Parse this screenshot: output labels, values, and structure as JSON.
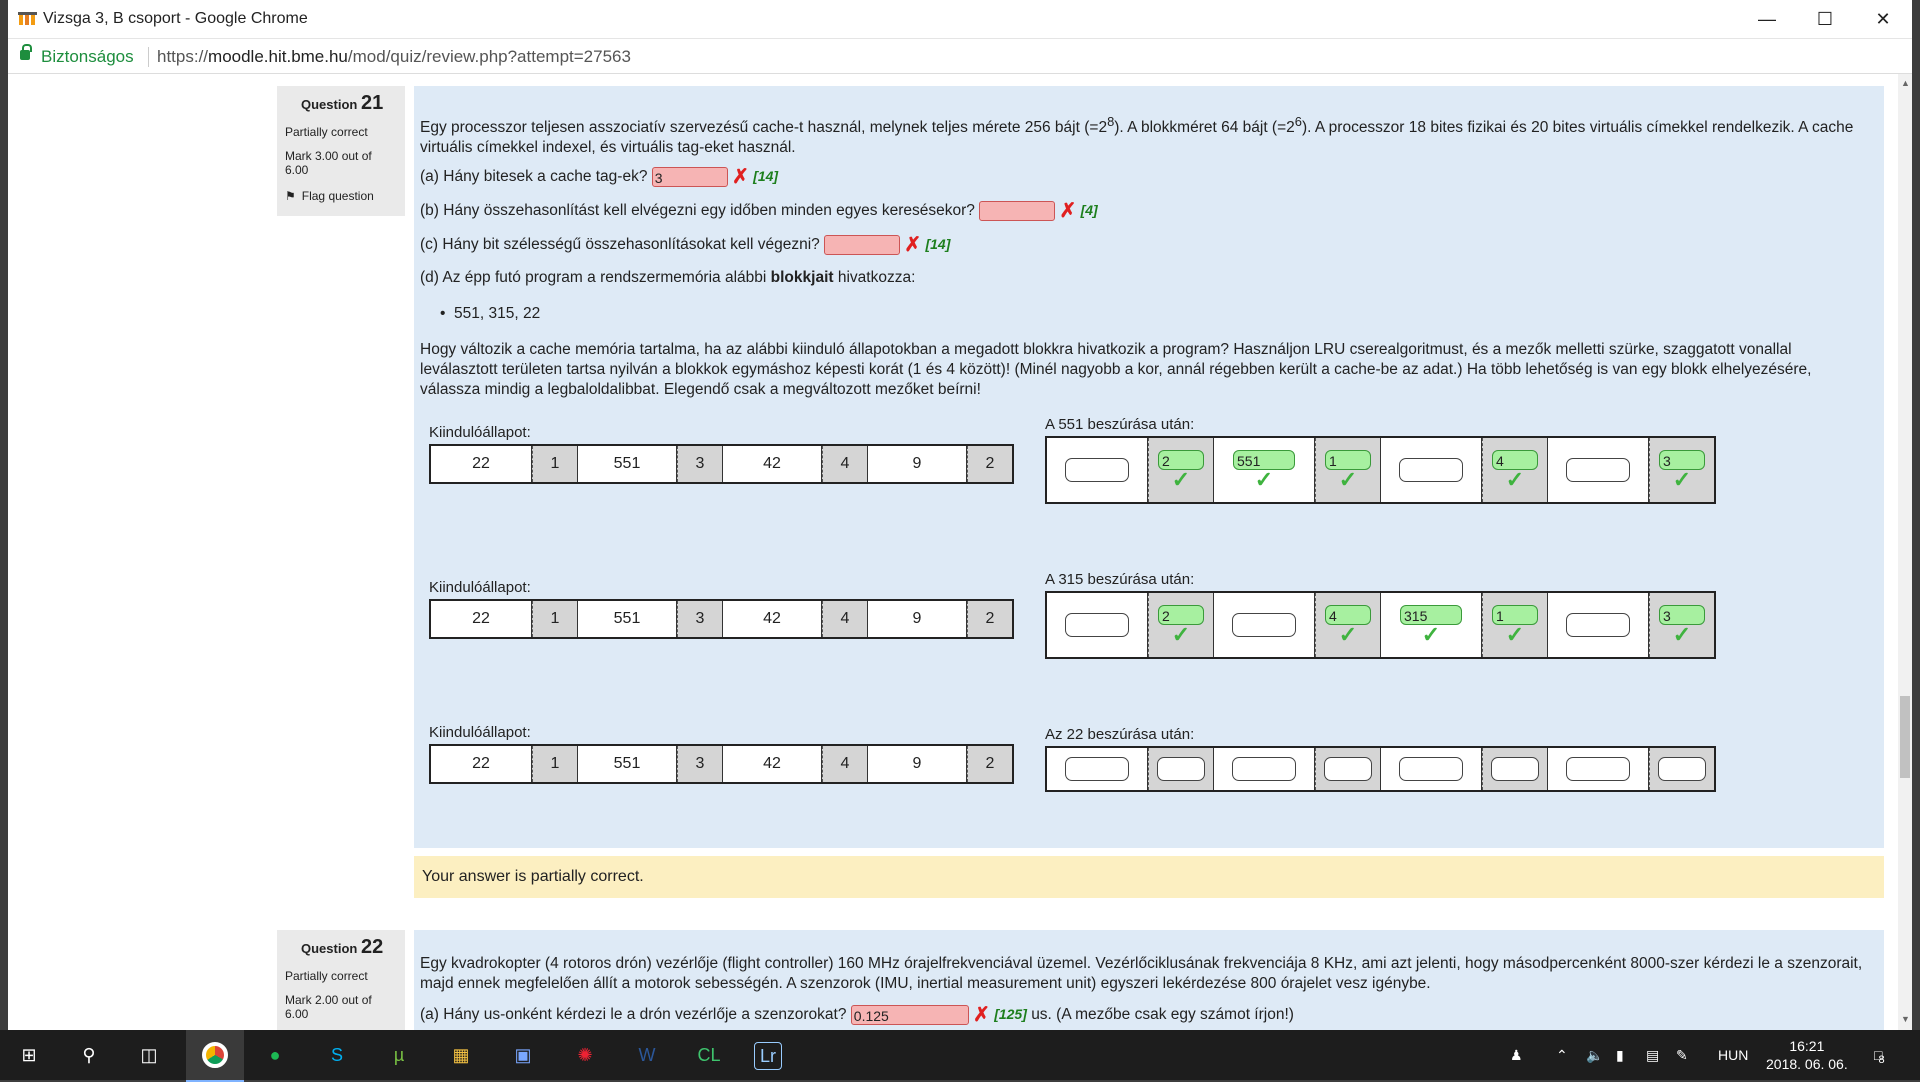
{
  "window": {
    "title": "Vizsga 3, B csoport - Google Chrome"
  },
  "addressbar": {
    "secure_label": "Biztonságos",
    "url_prefix": "https://",
    "url_host": "moodle.hit.bme.hu",
    "url_path": "/mod/quiz/review.php?attempt=27563"
  },
  "q21": {
    "label": "Question",
    "number": "21",
    "status": "Partially correct",
    "mark": "Mark 3.00 out of 6.00",
    "flag": "Flag question",
    "intro_a": "Egy processzor teljesen asszociatív szervezésű cache-t használ, melynek teljes mérete 256 bájt (=2",
    "intro_sup1": "8",
    "intro_b": "). A blokkméret 64 bájt (=2",
    "intro_sup2": "6",
    "intro_c": "). A processzor 18 bites fizikai és 20 bites virtuális címekkel rendelkezik. A cache virtuális címekkel indexel, és virtuális tag-eket használ.",
    "qa": "(a) Hány bitesek a cache tag-ek?",
    "qa_val": "3",
    "qa_fb": "[14]",
    "qb": "(b) Hány összehasonlítást kell elvégezni egy időben minden egyes keresésekor?",
    "qb_val": "",
    "qb_fb": "[4]",
    "qc": "(c) Hány bit szélességű összehasonlításokat kell végezni?",
    "qc_val": "",
    "qc_fb": "[14]",
    "qd_a": "(d) Az épp futó program a rendszermemória alábbi ",
    "qd_b": "blokkjait",
    "qd_c": " hivatkozza:",
    "blocks": "551, 315, 22",
    "para": "Hogy változik a cache memória tartalma, ha az alábbi kiinduló állapotokban a megadott blokkra hivatkozik a program? Használjon LRU cserealgoritmust, és a mezők melletti szürke, szaggatott vonallal leválasztott területen tartsa nyilván a blokkok egymáshoz képesti korát (1 és 4 között)! (Minél nagyobb a kor, annál régebben került a cache-be az adat.) Ha több lehetőség is van egy blokk elhelyezésére, válassza mindig a legbaloldalibbat. Elegendő csak a megváltozott mezőket beírni!",
    "init_label": "Kiindulóállapot:",
    "init_cells": [
      "22",
      "1",
      "551",
      "3",
      "42",
      "4",
      "9",
      "2"
    ],
    "after1": "A 551 beszúrása után:",
    "after1_vals": [
      "",
      "2",
      "551",
      "1",
      "",
      "4",
      "",
      "3"
    ],
    "after2": "A 315 beszúrása után:",
    "after2_vals": [
      "",
      "2",
      "",
      "4",
      "315",
      "1",
      "",
      "3"
    ],
    "after3": "Az 22 beszúrása után:",
    "feedback": "Your answer is partially correct."
  },
  "q22": {
    "label": "Question",
    "number": "22",
    "status": "Partially correct",
    "mark": "Mark 2.00 out of 6.00",
    "text": "Egy kvadrokopter (4 rotoros drón) vezérlője (flight controller) 160 MHz órajelfrekvenciával üzemel. Vezérlőciklusának frekvenciája 8 KHz, ami azt jelenti, hogy másodpercenként 8000-szer kérdezi le a szenzorait, majd ennek megfelelően állít a motorok sebességén. A szenzorok (IMU, inertial measurement unit) egyszeri lekérdezése 800 órajelet vesz igénybe.",
    "qa": "(a) Hány us-onként kérdezi le a drón vezérlője a szenzorokat?",
    "qa_val": "0.125",
    "qa_fb": "[125]",
    "qa_tail": "us. (A mezőbe csak egy számot írjon!)"
  },
  "taskbar": {
    "lang": "HUN",
    "time": "16:21",
    "date": "2018. 06. 06.",
    "notif": "8"
  }
}
